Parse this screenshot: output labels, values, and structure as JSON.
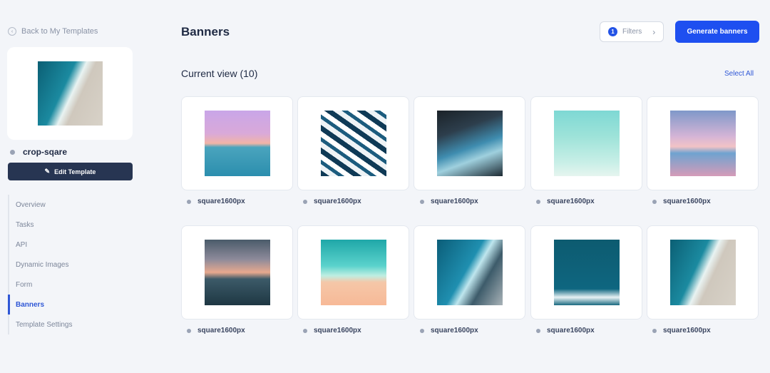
{
  "sidebar": {
    "back_label": "Back to My Templates",
    "template_name": "crop-sqare",
    "edit_label": "Edit Template",
    "nav": [
      "Overview",
      "Tasks",
      "API",
      "Dynamic Images",
      "Form",
      "Banners",
      "Template Settings"
    ],
    "active_nav": "Banners"
  },
  "header": {
    "title": "Banners",
    "filters_count": "1",
    "filters_label": "Filters",
    "generate_label": "Generate banners"
  },
  "content": {
    "current_view": "Current view (10)",
    "select_all": "Select All",
    "items": [
      {
        "label": "square1600px"
      },
      {
        "label": "square1600px"
      },
      {
        "label": "square1600px"
      },
      {
        "label": "square1600px"
      },
      {
        "label": "square1600px"
      },
      {
        "label": "square1600px"
      },
      {
        "label": "square1600px"
      },
      {
        "label": "square1600px"
      },
      {
        "label": "square1600px"
      },
      {
        "label": "square1600px"
      }
    ]
  },
  "colors": {
    "accent": "#1e4ff0",
    "dark_button": "#273552",
    "background": "#f3f5f9"
  }
}
